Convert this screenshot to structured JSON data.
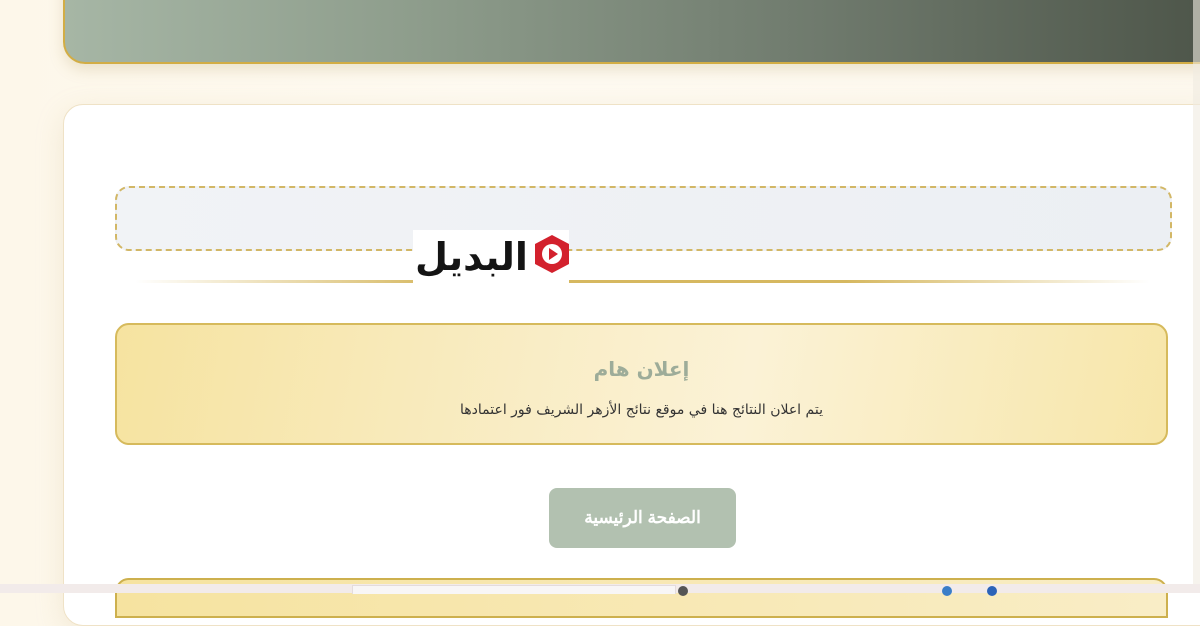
{
  "notice": {
    "title": "إعلان هام",
    "text": "يتم اعلان النتائج هنا في موقع نتائج الأزهر الشريف فور اعتمادها"
  },
  "home_button": {
    "label": "الصفحة الرئيسية"
  },
  "watermark": {
    "text": "البديل"
  },
  "colors": {
    "accent_gold": "#d2ad45",
    "header_green": "#6f7a6d",
    "button_green": "#b2c1b0"
  }
}
